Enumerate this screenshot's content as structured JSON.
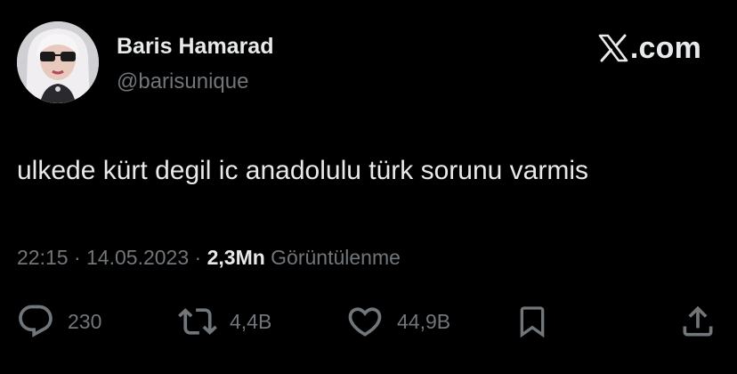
{
  "author": {
    "display_name": "Baris Hamarad",
    "handle": "@barisunique",
    "avatar_icon": "profile-photo"
  },
  "brand": {
    "logo_icon": "x-logo-icon",
    "domain": ".com"
  },
  "tweet": {
    "text": "ulkede kürt degil ic anadolulu türk sorunu varmis",
    "time": "22:15",
    "separator": "·",
    "date": "14.05.2023",
    "views_count": "2,3Mn",
    "views_label": "Görüntülenme"
  },
  "actions": {
    "reply": {
      "icon": "reply-icon",
      "count": "230"
    },
    "retweet": {
      "icon": "retweet-icon",
      "count": "4,4B"
    },
    "like": {
      "icon": "heart-icon",
      "count": "44,9B"
    },
    "bookmark": {
      "icon": "bookmark-icon"
    },
    "share": {
      "icon": "share-icon"
    }
  },
  "colors": {
    "background": "#000000",
    "primary_text": "#e7e9ea",
    "secondary_text": "#71767b"
  }
}
